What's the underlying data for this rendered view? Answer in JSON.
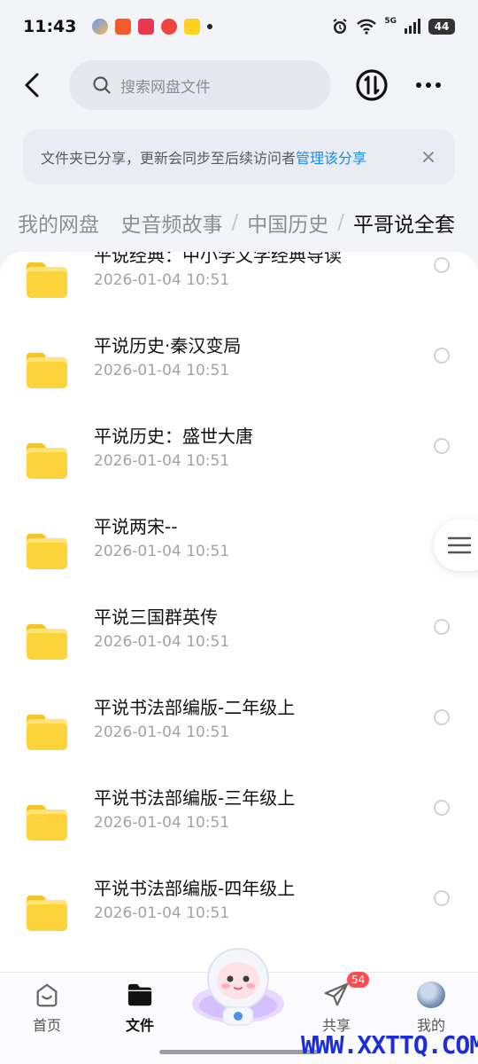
{
  "status_bar": {
    "time": "11:43",
    "network_label": "5G",
    "battery": "44",
    "notification_icons": [
      "baidu-netdisk-icon",
      "app-red-icon",
      "app-pink-icon",
      "weibo-icon",
      "meituan-icon"
    ]
  },
  "header": {
    "search_placeholder": "搜索网盘文件"
  },
  "notice": {
    "text": "文件夹已分享，更新会同步至后续访问者",
    "link": "管理该分享"
  },
  "breadcrumb": {
    "root": "我的网盘",
    "partial": "史音频故事",
    "middle": "中国历史",
    "current": "平哥说全套",
    "separator": "/"
  },
  "files": [
    {
      "name": "平说经典：中小学文学经典导读",
      "date": "2026-01-04  10:51"
    },
    {
      "name": "平说历史·秦汉变局",
      "date": "2026-01-04  10:51"
    },
    {
      "name": "平说历史：盛世大唐",
      "date": "2026-01-04  10:51"
    },
    {
      "name": "平说两宋--",
      "date": "2026-01-04  10:51"
    },
    {
      "name": "平说三国群英传",
      "date": "2026-01-04  10:51"
    },
    {
      "name": "平说书法部编版-二年级上",
      "date": "2026-01-04  10:51"
    },
    {
      "name": "平说书法部编版-三年级上",
      "date": "2026-01-04  10:51"
    },
    {
      "name": "平说书法部编版-四年级上",
      "date": "2026-01-04  10:51"
    }
  ],
  "tabbar": {
    "home": "首页",
    "files": "文件",
    "share": "共享",
    "share_badge": "54",
    "me": "我的"
  },
  "watermark": "WWW.XXTTQ.COM",
  "colors": {
    "accent": "#1a8cf0",
    "folder": "#fcd33a",
    "badge": "#ff4d4f",
    "watermark": "#1c2fd6"
  }
}
